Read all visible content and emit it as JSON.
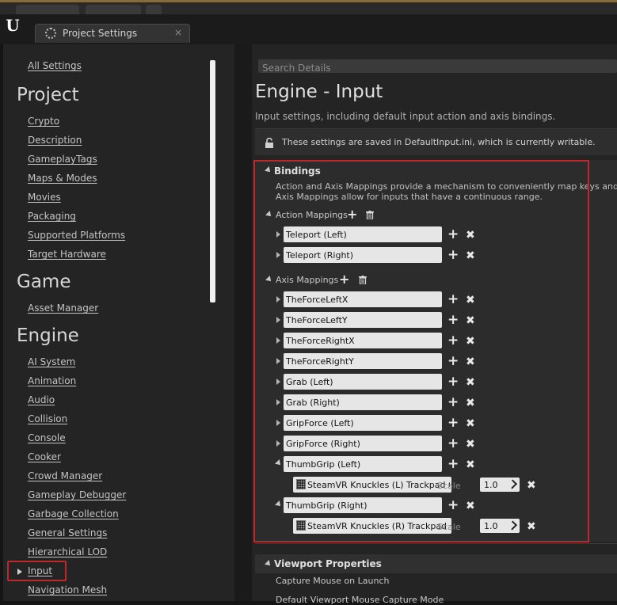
{
  "window": {
    "tab_title": "Project Settings",
    "tab_close": "×",
    "logo": "U"
  },
  "sidebar": {
    "all_settings": "All Settings",
    "sections": [
      {
        "title": "Project",
        "items": [
          "Crypto",
          "Description",
          "GameplayTags",
          "Maps & Modes",
          "Movies",
          "Packaging",
          "Supported Platforms",
          "Target Hardware"
        ]
      },
      {
        "title": "Game",
        "items": [
          "Asset Manager"
        ]
      },
      {
        "title": "Engine",
        "items": [
          "AI System",
          "Animation",
          "Audio",
          "Collision",
          "Console",
          "Cooker",
          "Crowd Manager",
          "Gameplay Debugger",
          "Garbage Collection",
          "General Settings",
          "Hierarchical LOD",
          "Input",
          "Navigation Mesh"
        ]
      }
    ],
    "selected": "Input"
  },
  "main": {
    "search_placeholder": "Search Details",
    "title": "Engine - Input",
    "description": "Input settings, including default input action and axis bindings.",
    "notice": "These settings are saved in DefaultInput.ini, which is currently writable.",
    "bindings": {
      "title": "Bindings",
      "desc_line1": "Action and Axis Mappings provide a mechanism to conveniently map keys and axes to",
      "desc_line2": "Axis Mappings allow for inputs that have a continuous range.",
      "action_header": "Action Mappings",
      "action_mappings": [
        "Teleport (Left)",
        "Teleport (Right)"
      ],
      "axis_header": "Axis Mappings",
      "axis_mappings": [
        "TheForceLeftX",
        "TheForceLeftY",
        "TheForceRightX",
        "TheForceRightY",
        "Grab (Left)",
        "Grab (Right)",
        "GripForce (Left)",
        "GripForce (Right)",
        "ThumbGrip (Left)",
        "ThumbGrip (Right)"
      ],
      "expanded": [
        {
          "name": "ThumbGrip (Left)",
          "key": "SteamVR Knuckles (L) Trackpad GripForce",
          "scale_label": "Scale",
          "scale": "1.0"
        },
        {
          "name": "ThumbGrip (Right)",
          "key": "SteamVR Knuckles (R) Trackpad GripForce",
          "scale_label": "Scale",
          "scale": "1.0"
        }
      ]
    },
    "viewport": {
      "title": "Viewport Properties",
      "items": [
        "Capture Mouse on Launch",
        "Default Viewport Mouse Capture Mode"
      ]
    }
  },
  "icons": {
    "plus": "+",
    "close": "✖"
  }
}
